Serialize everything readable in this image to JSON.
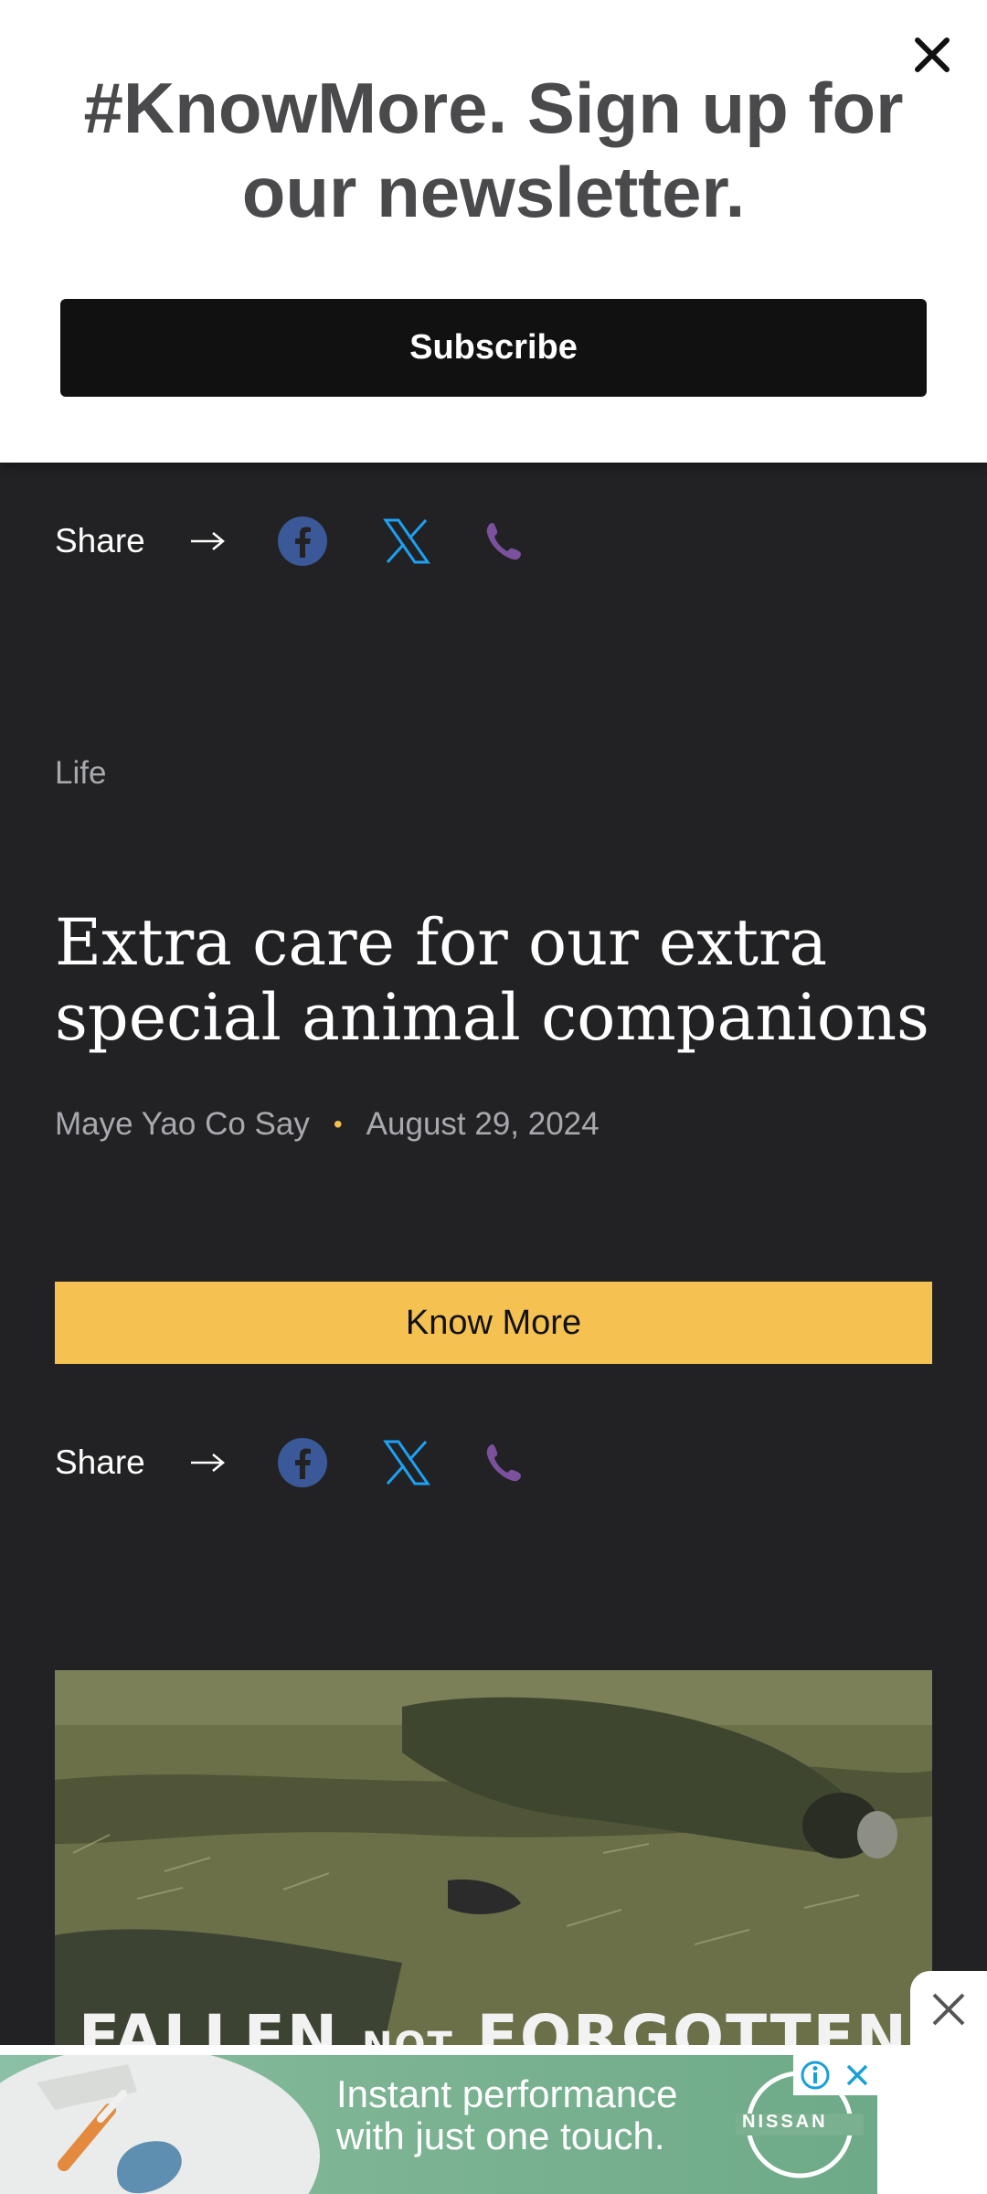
{
  "newsletter": {
    "title": "#KnowMore. Sign up for our newsletter.",
    "subscribe_label": "Subscribe"
  },
  "share": {
    "label": "Share"
  },
  "article": {
    "category": "Life",
    "headline": "Extra care for our extra special animal companions",
    "author": "Maye Yao Co Say",
    "date": "August 29, 2024",
    "cta_label": "Know More"
  },
  "photo": {
    "caption_part1": "FALLEN",
    "caption_part2": "NOT",
    "caption_part3": "FORGOTTEN"
  },
  "ad": {
    "line1": "Instant performance",
    "line2": "with just one touch.",
    "brand": "NISSAN"
  },
  "colors": {
    "background": "#222224",
    "accent": "#f5c252",
    "facebook": "#3b5998",
    "twitter": "#1da1f2",
    "phone": "#7b519d"
  },
  "icons": [
    "close-icon",
    "arrow-right-icon",
    "facebook-icon",
    "x-twitter-icon",
    "phone-icon",
    "adchoices-icon"
  ]
}
